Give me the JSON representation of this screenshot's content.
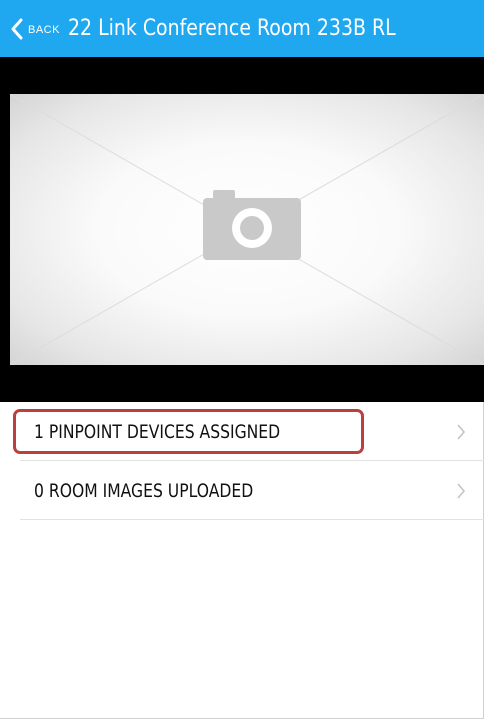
{
  "nav": {
    "back_label": "Back",
    "title": "22 Link Conference Room 233B RL",
    "bar_color": "#1fa8ef"
  },
  "image": {
    "placeholder_icon": "camera-icon"
  },
  "list": {
    "items": [
      {
        "label": "1 PINPOINT DEVICES ASSIGNED",
        "icon": "chevron-right-icon"
      },
      {
        "label": "0 ROOM IMAGES UPLOADED",
        "icon": "chevron-right-icon"
      }
    ]
  },
  "colors": {
    "highlight": "#b94040",
    "separator": "#e2e2e2"
  }
}
